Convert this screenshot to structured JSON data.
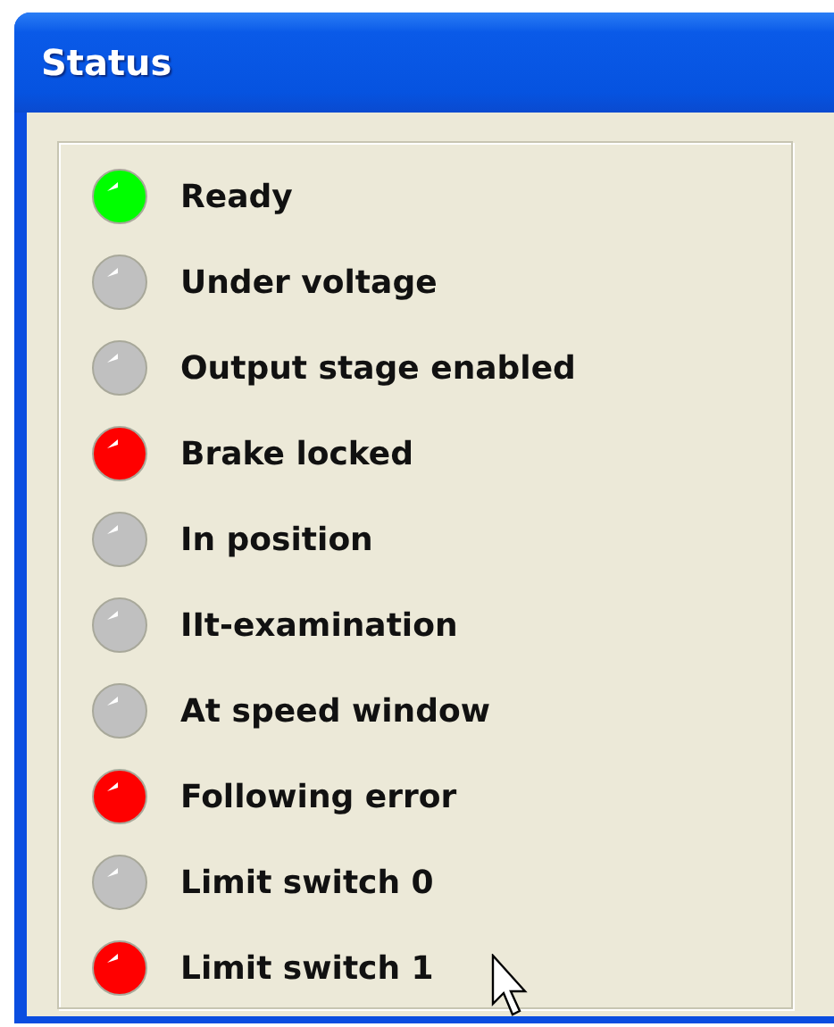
{
  "window": {
    "title": "Status"
  },
  "indicators": [
    {
      "label": "Ready",
      "color": "#00ff00"
    },
    {
      "label": "Under voltage",
      "color": "#c0c0c0"
    },
    {
      "label": "Output stage enabled",
      "color": "#c0c0c0"
    },
    {
      "label": "Brake locked",
      "color": "#ff0000"
    },
    {
      "label": "In position",
      "color": "#c0c0c0"
    },
    {
      "label": "IIt-examination",
      "color": "#c0c0c0"
    },
    {
      "label": "At speed window",
      "color": "#c0c0c0"
    },
    {
      "label": "Following error",
      "color": "#ff0000"
    },
    {
      "label": "Limit switch 0",
      "color": "#c0c0c0"
    },
    {
      "label": "Limit switch 1",
      "color": "#ff0000"
    }
  ]
}
